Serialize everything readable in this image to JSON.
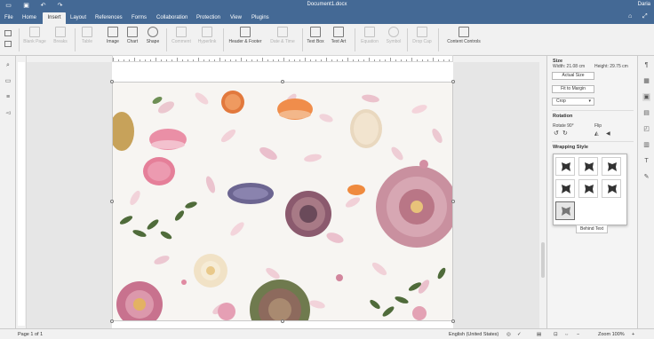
{
  "titlebar": {
    "doc_title": "Document1.docx",
    "user": "Daria",
    "icons": [
      "save-icon",
      "print-icon",
      "undo-icon",
      "redo-icon",
      "open-location-icon",
      "fullscreen-icon"
    ]
  },
  "tabs": [
    {
      "label": "File"
    },
    {
      "label": "Home"
    },
    {
      "label": "Insert",
      "active": true
    },
    {
      "label": "Layout"
    },
    {
      "label": "References"
    },
    {
      "label": "Forms"
    },
    {
      "label": "Collaboration"
    },
    {
      "label": "Protection"
    },
    {
      "label": "View"
    },
    {
      "label": "Plugins"
    }
  ],
  "toolbar": {
    "blank_page": "Blank Page",
    "breaks": "Breaks",
    "table": "Table",
    "image": "Image",
    "chart": "Chart",
    "shape": "Shape",
    "comment": "Comment",
    "hyperlink": "Hyperlink",
    "header_footer": "Header & Footer",
    "date_time": "Date & Time",
    "text_box": "Text Box",
    "text_art": "Text Art",
    "equation": "Equation",
    "symbol": "Symbol",
    "drop_cap": "Drop Cap",
    "content_controls": "Content Controls"
  },
  "panel": {
    "size_heading": "Size",
    "width": "Width: 21.08 cm",
    "height": "Height: 29.75 cm",
    "actual_size": "Actual Size",
    "fit_to_margin": "Fit to Margin",
    "crop": "Crop",
    "rotation_heading": "Rotation",
    "rotate_90": "Rotate 90°",
    "flip": "Flip",
    "wrapping_heading": "Wrapping Style",
    "tooltip": "Behind Text",
    "wrap_styles": [
      "inline",
      "square",
      "tight",
      "through",
      "top-and-bottom",
      "in-front",
      "behind"
    ]
  },
  "status": {
    "page": "Page 1 of 1",
    "language": "English (United States)",
    "zoom": "Zoom 100%",
    "zoom_out": "−",
    "zoom_in": "+"
  },
  "colors": {
    "titlebar": "#446995",
    "active_tab_bg": "#f1f1f1"
  }
}
